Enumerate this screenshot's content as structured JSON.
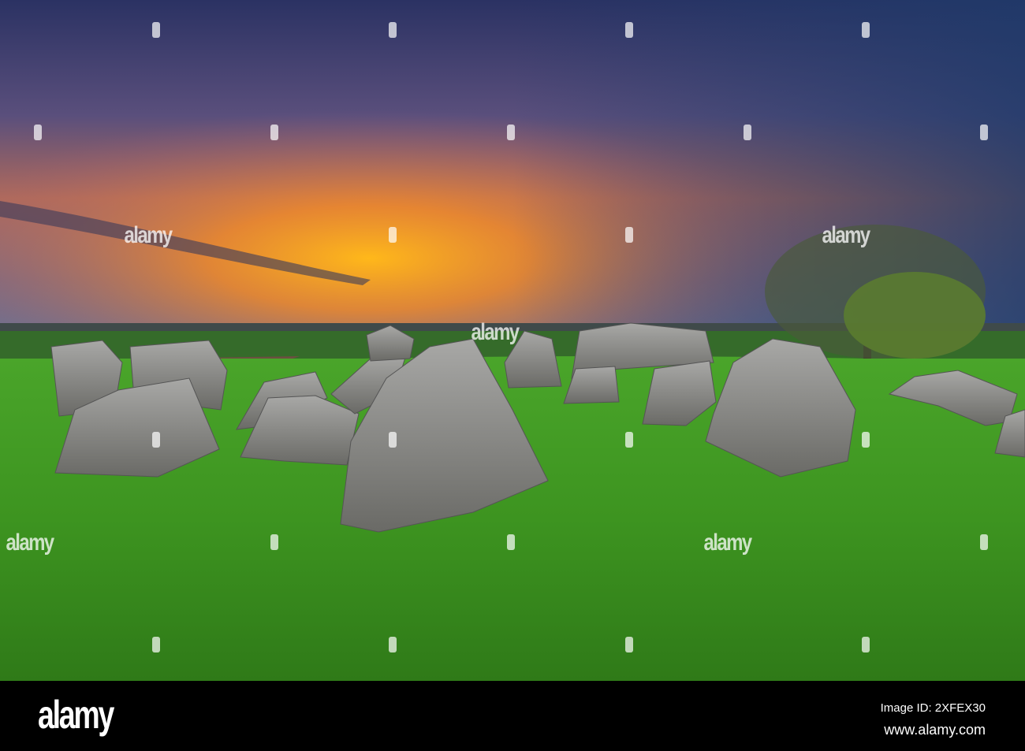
{
  "watermark": {
    "text": "alamy"
  },
  "footer": {
    "logo": "alamy",
    "image_id": "Image ID: 2XFEX30",
    "url": "www.alamy.com"
  },
  "colors": {
    "sky_top": "#2a3a6a",
    "sunset": "#ff9a1a",
    "grass": "#3f9a1e",
    "stone": "#8a8a86"
  }
}
